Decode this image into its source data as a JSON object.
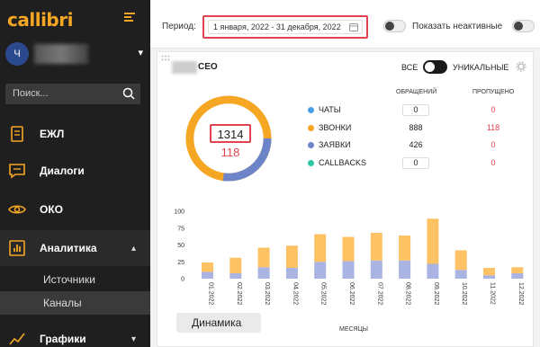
{
  "sidebar": {
    "logo": "callibri",
    "user_initial": "Ч",
    "search_placeholder": "Поиск...",
    "items": [
      {
        "label": "ЕЖЛ",
        "icon": "book-icon"
      },
      {
        "label": "Диалоги",
        "icon": "chat-icon"
      },
      {
        "label": "ОКО",
        "icon": "eye-icon"
      },
      {
        "label": "Аналитика",
        "icon": "analytics-icon",
        "expanded": true
      },
      {
        "label": "Графики",
        "icon": "chart-icon"
      }
    ],
    "subitems": [
      {
        "label": "Источники"
      },
      {
        "label": "Каналы",
        "active": true
      }
    ]
  },
  "header": {
    "period_label": "Период:",
    "period_value": "1 января, 2022 - 31 декабря, 2022",
    "show_inactive_label": "Показать неактивные"
  },
  "card": {
    "title_suffix": "CEO",
    "toggle_all": "ВСЕ",
    "toggle_unique": "УНИКАЛЬНЫЕ",
    "total": "1314",
    "missed": "118",
    "col_requests": "ОБРАЩЕНИЙ",
    "col_missed": "ПРОПУЩЕНО",
    "rows": [
      {
        "label": "ЧАТЫ",
        "value": "0",
        "missed": "0",
        "color": "#4a9fe8"
      },
      {
        "label": "ЗВОНКИ",
        "value": "888",
        "missed": "118",
        "color": "#f5a623"
      },
      {
        "label": "ЗАЯВКИ",
        "value": "426",
        "missed": "0",
        "color": "#6e84c9"
      },
      {
        "label": "CALLBACKS",
        "value": "0",
        "missed": "0",
        "color": "#2ec9a4"
      }
    ],
    "months_label": "МЕСЯЦЫ",
    "dynamics_tab": "Динамика"
  },
  "colors": {
    "accent": "#f5a623",
    "alert": "#e0444f",
    "bar_orange": "#fcc263",
    "bar_blue": "#aab4e3"
  },
  "chart_data": {
    "type": "bar",
    "stacked": true,
    "categories": [
      "01.2022",
      "02.2022",
      "03.2022",
      "04.2022",
      "05.2022",
      "06.2022",
      "07.2022",
      "08.2022",
      "09.2022",
      "10.2022",
      "11.2022",
      "12.2022"
    ],
    "series": [
      {
        "values": [
          10,
          8,
          17,
          16,
          25,
          26,
          27,
          27,
          22,
          13,
          5,
          8
        ]
      },
      {
        "values": [
          14,
          23,
          29,
          33,
          41,
          36,
          41,
          37,
          67,
          29,
          11,
          9
        ]
      }
    ],
    "yticks": [
      0,
      25,
      50,
      75,
      100
    ],
    "ylim": [
      0,
      100
    ],
    "xlabel": "МЕСЯЦЫ"
  }
}
